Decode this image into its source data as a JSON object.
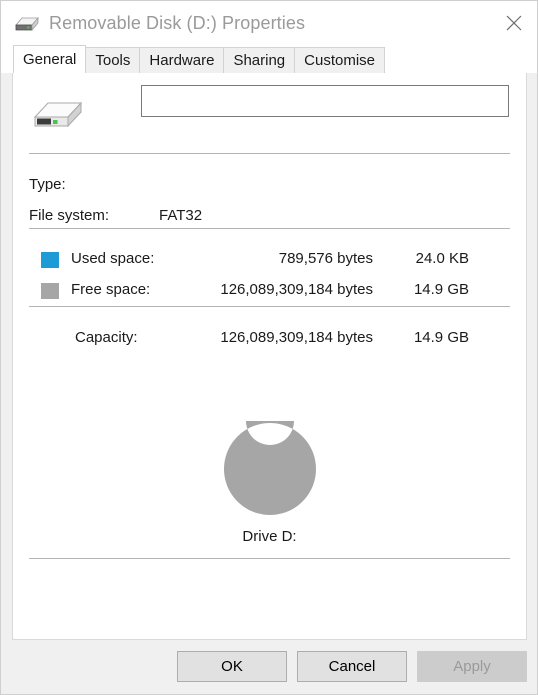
{
  "window": {
    "title": "Removable Disk (D:) Properties",
    "icon": "removable-drive-icon",
    "close_label": "×"
  },
  "tabs": [
    {
      "label": "General",
      "active": true
    },
    {
      "label": "Tools",
      "active": false
    },
    {
      "label": "Hardware",
      "active": false
    },
    {
      "label": "Sharing",
      "active": false
    },
    {
      "label": "Customise",
      "active": false
    }
  ],
  "general": {
    "volume_name": "",
    "volume_name_placeholder": "",
    "type_label": "Type:",
    "type_value": "",
    "filesystem_label": "File system:",
    "filesystem_value": "FAT32",
    "used": {
      "label": "Used space:",
      "bytes": "789,576 bytes",
      "size": "24.0 KB",
      "color": "#1d9bd7"
    },
    "free": {
      "label": "Free space:",
      "bytes": "126,089,309,184 bytes",
      "size": "14.9 GB",
      "color": "#a6a6a6"
    },
    "capacity": {
      "label": "Capacity:",
      "bytes": "126,089,309,184 bytes",
      "size": "14.9 GB"
    },
    "drive_caption": "Drive D:"
  },
  "chart_data": {
    "type": "pie",
    "title": "Drive D:",
    "categories": [
      "Used space",
      "Free space"
    ],
    "values": [
      789576,
      126089309184
    ],
    "percentages": [
      0.0006,
      99.9994
    ],
    "colors": [
      "#1d9bd7",
      "#a6a6a6"
    ],
    "donut": true,
    "legend": "left-list",
    "units": "bytes"
  },
  "buttons": {
    "ok": "OK",
    "cancel": "Cancel",
    "apply": "Apply"
  }
}
